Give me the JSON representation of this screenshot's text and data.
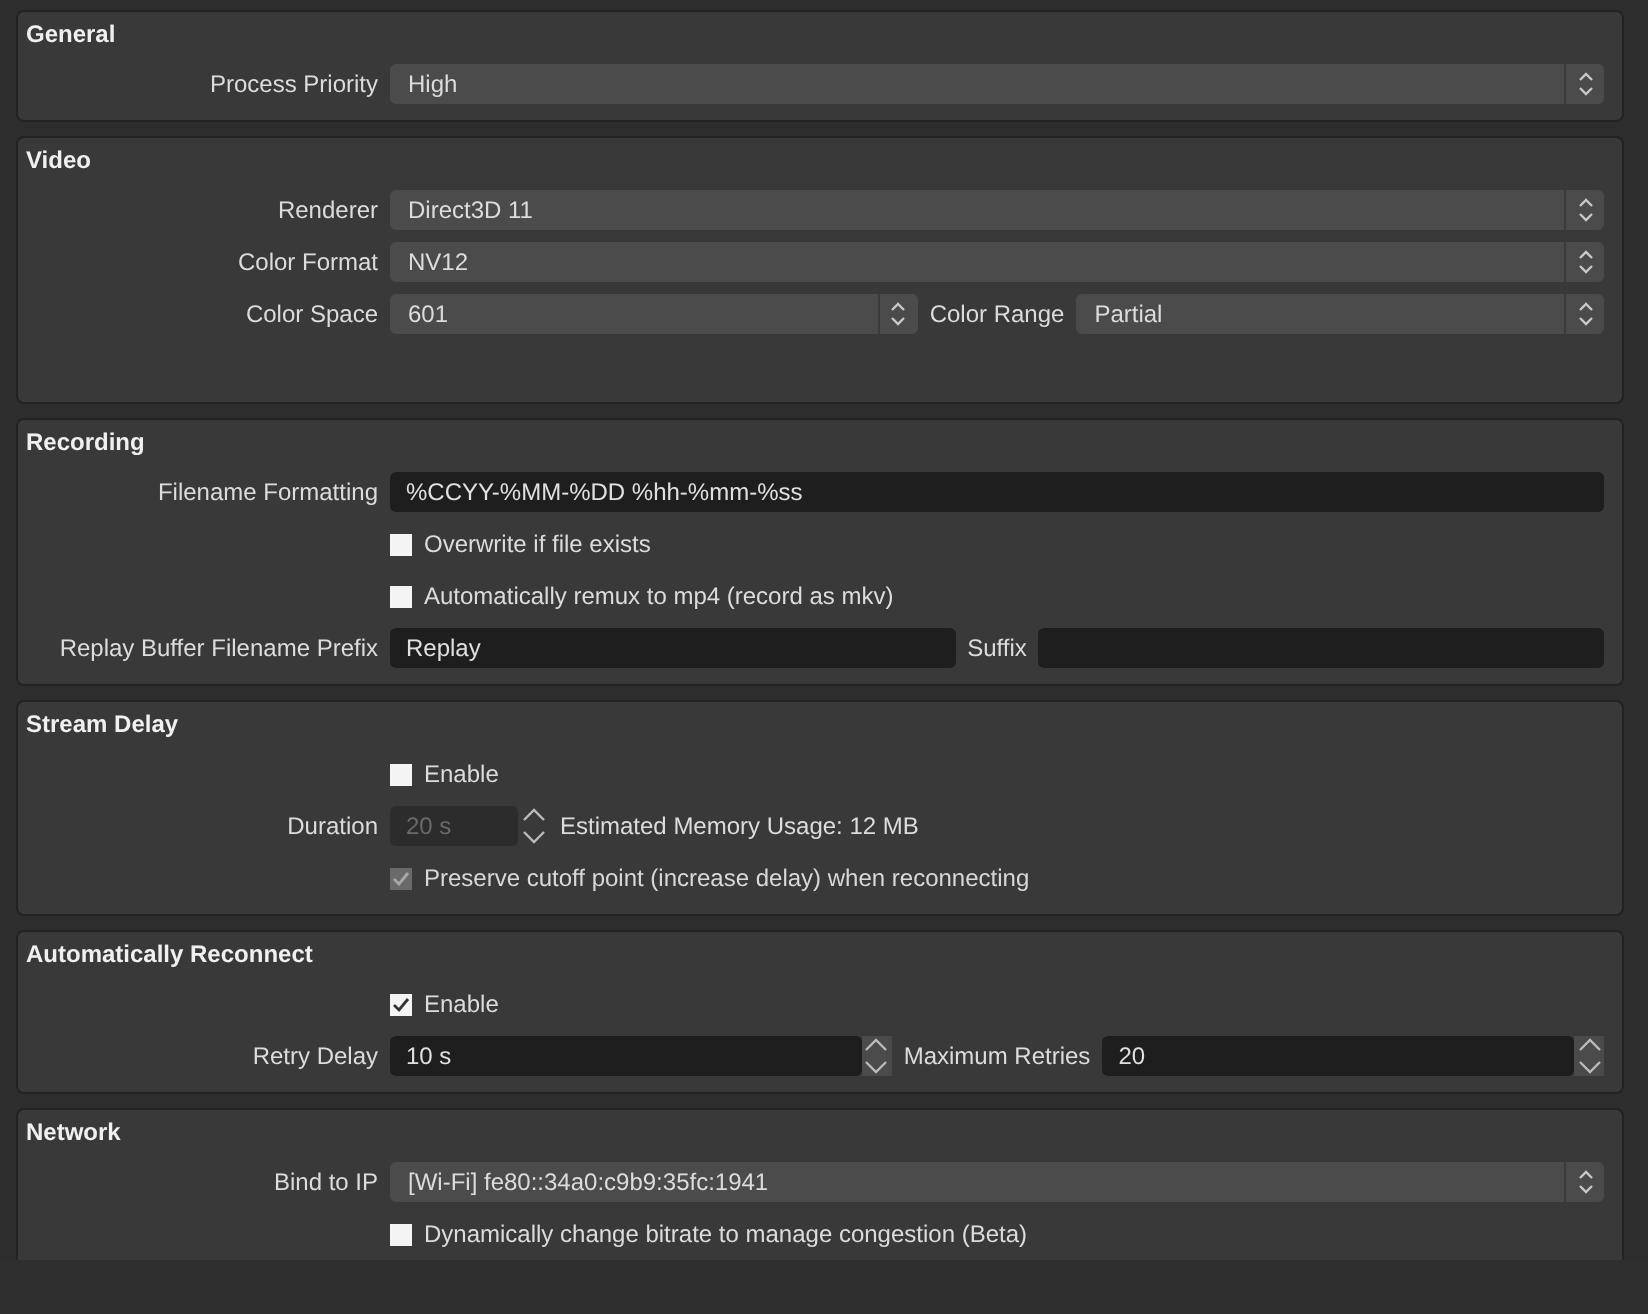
{
  "groups": [
    {
      "title": "General",
      "rows": [
        {
          "kind": "combo",
          "label": "Process Priority",
          "value": "High"
        }
      ]
    },
    {
      "title": "Video",
      "rows": [
        {
          "kind": "combo",
          "label": "Renderer",
          "value": "Direct3D 11"
        },
        {
          "kind": "combo",
          "label": "Color Format",
          "value": "NV12"
        },
        {
          "kind": "combo_pair",
          "label": "Color Space",
          "value": "601",
          "label2": "Color Range",
          "value2": "Partial"
        }
      ]
    },
    {
      "title": "Recording",
      "rows": [
        {
          "kind": "text",
          "label": "Filename Formatting",
          "value": "%CCYY-%MM-%DD %hh-%mm-%ss"
        },
        {
          "kind": "checkbox",
          "text": "Overwrite if file exists",
          "checked": false,
          "disabled": false
        },
        {
          "kind": "checkbox",
          "text": "Automatically remux to mp4 (record as mkv)",
          "checked": false,
          "disabled": false
        },
        {
          "kind": "text_pair",
          "label": "Replay Buffer Filename Prefix",
          "value": "Replay",
          "label2": "Suffix",
          "value2": ""
        }
      ]
    },
    {
      "title": "Stream Delay",
      "rows": [
        {
          "kind": "checkbox",
          "text": "Enable",
          "checked": false,
          "disabled": false
        },
        {
          "kind": "spin_info",
          "label": "Duration",
          "value": "20 s",
          "disabled": true,
          "info": "Estimated Memory Usage: 12 MB"
        },
        {
          "kind": "checkbox",
          "text": "Preserve cutoff point (increase delay) when reconnecting",
          "checked": true,
          "disabled": true
        }
      ]
    },
    {
      "title": "Automatically Reconnect",
      "rows": [
        {
          "kind": "checkbox",
          "text": "Enable",
          "checked": true,
          "disabled": false
        },
        {
          "kind": "spin_pair",
          "label": "Retry Delay",
          "value": "10 s",
          "label2": "Maximum Retries",
          "value2": "20"
        }
      ]
    },
    {
      "title": "Network",
      "rows": [
        {
          "kind": "combo",
          "label": "Bind to IP",
          "value": "[Wi-Fi] fe80::34a0:c9b9:35fc:1941"
        },
        {
          "kind": "checkbox",
          "text": "Dynamically change bitrate to manage congestion (Beta)",
          "checked": false,
          "disabled": false
        }
      ]
    }
  ]
}
